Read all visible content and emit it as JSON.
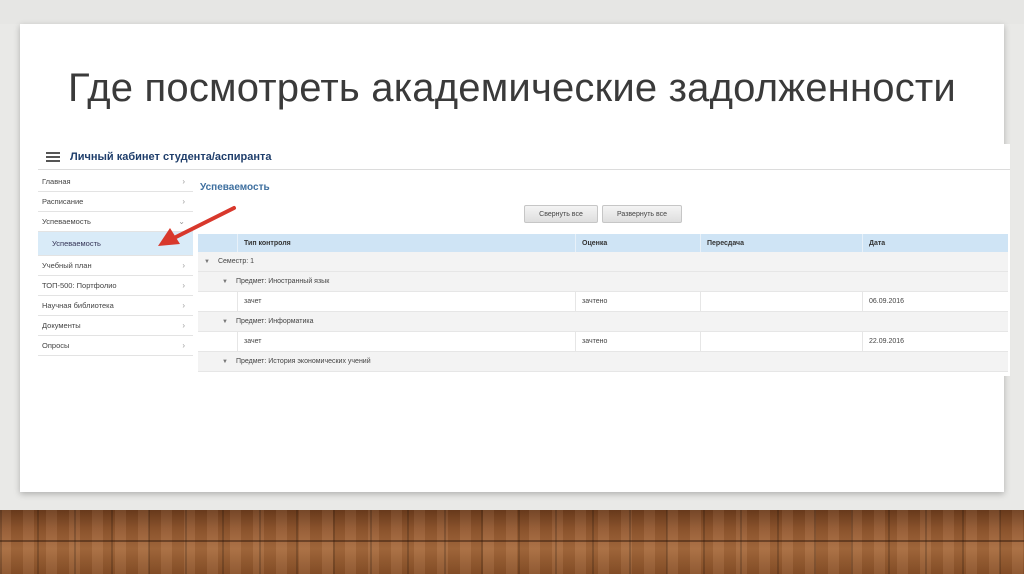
{
  "slide": {
    "title": "Где посмотреть академические задолженности"
  },
  "app": {
    "title": "Личный кабинет студента/аспиранта",
    "sidebar": [
      {
        "label": "Главная",
        "chevron": "›"
      },
      {
        "label": "Расписание",
        "chevron": "›"
      },
      {
        "label": "Успеваемость",
        "chevron": "⌄"
      },
      {
        "label": "Успеваемость",
        "chevron": ""
      },
      {
        "label": "Учебный план",
        "chevron": "›"
      },
      {
        "label": "ТОП-500: Портфолио",
        "chevron": "›"
      },
      {
        "label": "Научная библиотека",
        "chevron": "›"
      },
      {
        "label": "Документы",
        "chevron": "›"
      },
      {
        "label": "Опросы",
        "chevron": "›"
      }
    ],
    "section_title": "Успеваемость",
    "buttons": {
      "collapse": "Свернуть все",
      "expand": "Развернуть все"
    },
    "grid": {
      "columns": [
        "Тип контроля",
        "Оценка",
        "Пересдача",
        "Дата"
      ],
      "semester": "Семестр: 1",
      "subjects": [
        {
          "title": "Предмет: Иностранный язык",
          "type": "зачет",
          "grade": "зачтено",
          "retake": "",
          "date": "06.09.2016"
        },
        {
          "title": "Предмет: Информатика",
          "type": "зачет",
          "grade": "зачтено",
          "retake": "",
          "date": "22.09.2016"
        },
        {
          "title": "Предмет: История экономических учений"
        }
      ]
    },
    "colors": {
      "accent": "#3e6f9f",
      "header_bg": "#cfe4f5",
      "selected_bg": "#d9ebf8",
      "arrow": "#d8382c"
    },
    "icons": {
      "menu": "menu-icon",
      "expand": "chevron-right-icon",
      "group": "caret-down-icon",
      "annotation": "red-arrow"
    }
  }
}
